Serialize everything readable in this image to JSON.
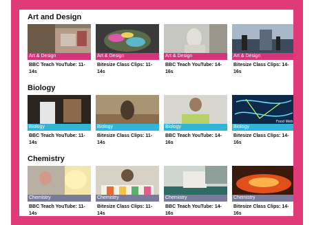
{
  "colors": {
    "frame": "#e03a78",
    "art_tag": "#d6337a",
    "bio_tag": "#2fb5d8",
    "chem_tag": "#7a7a9c"
  },
  "sections": [
    {
      "title": "Art and Design",
      "cards": [
        {
          "tag": "Art & Design",
          "caption": "BBC Teach YouTube: 11-14s"
        },
        {
          "tag": "Art & Design",
          "caption": "Bitesize Class Clips: 11-14s"
        },
        {
          "tag": "Art & Design",
          "caption": "BBC Teach YouTube: 14-16s"
        },
        {
          "tag": "Art & Design",
          "caption": "Bitesize Class Clips: 14-16s"
        }
      ]
    },
    {
      "title": "Biology",
      "cards": [
        {
          "tag": "Biology",
          "caption": "BBC Teach YouTube: 11-14s"
        },
        {
          "tag": "Biology",
          "caption": "Bitesize Class Clips: 11-14s"
        },
        {
          "tag": "Biology",
          "caption": "BBC Teach YouTube: 14-16s"
        },
        {
          "tag": "Biology",
          "caption": "Bitesize Class Clips: 14-16s",
          "overlay": "Food Web"
        }
      ]
    },
    {
      "title": "Chemistry",
      "cards": [
        {
          "tag": "Chemistry",
          "caption": "BBC Teach YouTube: 11-14s"
        },
        {
          "tag": "Chemistry",
          "caption": "Bitesize Class Clips: 11-14s"
        },
        {
          "tag": "Chemistry",
          "caption": "BBC Teach YouTube: 14-16s"
        },
        {
          "tag": "Chemistry",
          "caption": "Bitesize Class Clips: 14-16s"
        }
      ]
    }
  ]
}
